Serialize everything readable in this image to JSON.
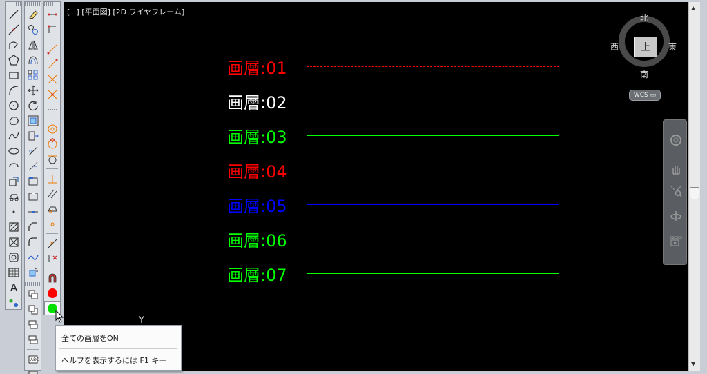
{
  "viewport": {
    "label": "[−] [平面図] [2D ワイヤフレーム]"
  },
  "layers": [
    {
      "label": "画層:01",
      "color": "#ff0000",
      "linetype": "dashdot"
    },
    {
      "label": "画層:02",
      "color": "#ffffff",
      "linetype": "continuous"
    },
    {
      "label": "画層:03",
      "color": "#00ff00",
      "linetype": "continuous"
    },
    {
      "label": "画層:04",
      "color": "#ff0000",
      "linetype": "continuous"
    },
    {
      "label": "画層:05",
      "color": "#0000ff",
      "linetype": "continuous"
    },
    {
      "label": "画層:06",
      "color": "#00ff00",
      "linetype": "continuous"
    },
    {
      "label": "画層:07",
      "color": "#00ff00",
      "linetype": "continuous"
    }
  ],
  "viewcube": {
    "north": "北",
    "south": "南",
    "east": "東",
    "west": "西",
    "face": "上",
    "wcs": "WCS ▭"
  },
  "ucs_axis_label": "Y",
  "tooltip": {
    "title": "全ての画層をON",
    "help": "ヘルプを表示するには F1 キー"
  },
  "layer_toolbar": {
    "red_button_color": "#ff0000",
    "green_button_color": "#00e000"
  }
}
